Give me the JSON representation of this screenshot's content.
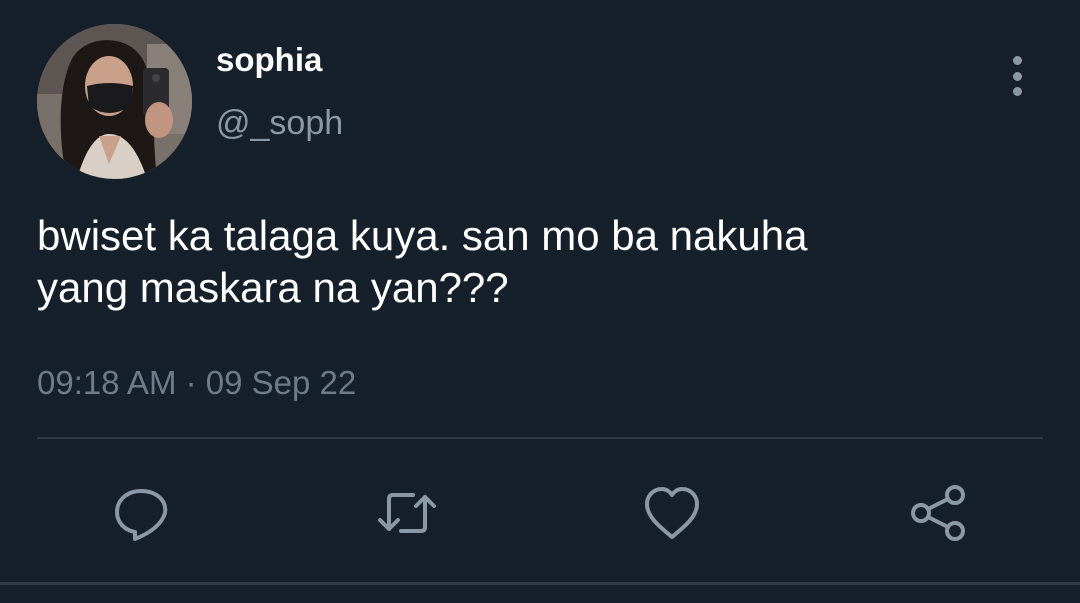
{
  "tweet": {
    "author": {
      "display_name": "sophia",
      "handle": "@_soph",
      "avatar_icon": "profile-photo"
    },
    "text_lines": [
      "bwiset ka talaga kuya. san mo ba nakuha",
      "yang maskara na yan???"
    ],
    "timestamp": "09:18 AM · 09 Sep 22"
  },
  "actions": [
    {
      "name": "reply",
      "icon": "comment-bubble-icon"
    },
    {
      "name": "retweet",
      "icon": "retweet-arrows-icon"
    },
    {
      "name": "like",
      "icon": "heart-icon"
    },
    {
      "name": "share",
      "icon": "share-nodes-icon"
    }
  ],
  "menu": {
    "icon": "vertical-dots-icon"
  },
  "colors": {
    "background": "#15202b",
    "primary_text": "#ffffff",
    "secondary_text": "#8b98a5",
    "icon": "#8b98a5",
    "divider": "#2f3b47"
  }
}
